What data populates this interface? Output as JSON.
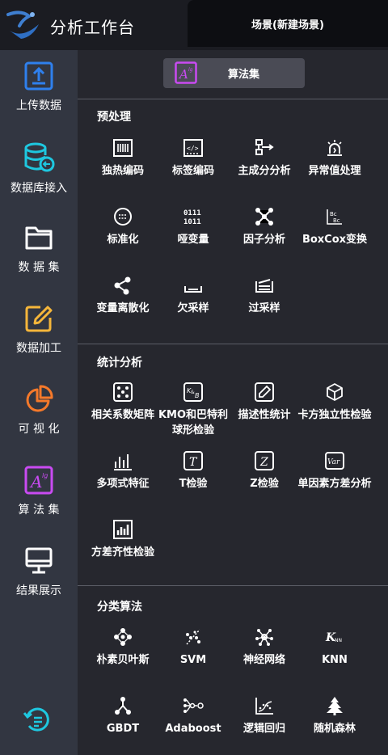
{
  "header": {
    "app_title": "分析工作台",
    "scene_tab": "场景(新建场景)"
  },
  "sidebar": {
    "items": [
      {
        "label": "上传数据",
        "icon": "upload-icon"
      },
      {
        "label": "数据库接入",
        "icon": "database-icon"
      },
      {
        "label": "数 据 集",
        "icon": "folder-icon"
      },
      {
        "label": "数据加工",
        "icon": "edit-icon"
      },
      {
        "label": "可 视 化",
        "icon": "pie-chart-icon"
      },
      {
        "label": "算 法 集",
        "icon": "algorithm-icon"
      },
      {
        "label": "结果展示",
        "icon": "monitor-icon"
      }
    ],
    "bottom_icon": "history-icon"
  },
  "main": {
    "pill_label": "算法集",
    "sections": [
      {
        "title": "预处理",
        "tools": [
          "独热编码",
          "标签编码",
          "主成分分析",
          "异常值处理",
          "标准化",
          "哑变量",
          "因子分析",
          "BoxCox变换",
          "变量离散化",
          "欠采样",
          "过采样"
        ]
      },
      {
        "title": "统计分析",
        "tools": [
          "相关系数矩阵",
          "KMO和巴特利球形检验",
          "描述性统计",
          "卡方独立性检验",
          "多项式特征",
          "T检验",
          "Z检验",
          "单因素方差分析",
          "方差齐性检验"
        ]
      },
      {
        "title": "分类算法",
        "tools": [
          "朴素贝叶斯",
          "SVM",
          "神经网络",
          "KNN",
          "GBDT",
          "Adaboost",
          "逻辑回归",
          "随机森林"
        ]
      }
    ]
  },
  "colors": {
    "upload": "#2f80ed",
    "database": "#1ec8e0",
    "edit": "#f5b63a",
    "pie": "#f5792a",
    "algorithm": "#c94bf2"
  }
}
